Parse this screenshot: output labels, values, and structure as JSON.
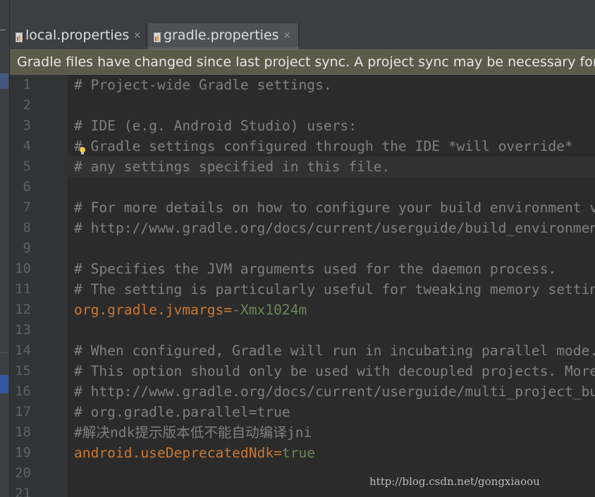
{
  "tabs": [
    {
      "label": "local.properties",
      "close": "×",
      "active": false
    },
    {
      "label": "gradle.properties",
      "close": "×",
      "active": true
    }
  ],
  "banner": {
    "message": "Gradle files have changed since last project sync. A project sync may be necessary for the IDE to work properly."
  },
  "editor": {
    "lines": [
      {
        "n": "1",
        "text": "# Project-wide Gradle settings."
      },
      {
        "n": "2",
        "text": ""
      },
      {
        "n": "3",
        "text": "# IDE (e.g. Android Studio) users:"
      },
      {
        "n": "4",
        "text": "# Gradle settings configured through the IDE *will override*"
      },
      {
        "n": "5",
        "text": "# any settings specified in this file."
      },
      {
        "n": "6",
        "text": ""
      },
      {
        "n": "7",
        "text": "# For more details on how to configure your build environment visit"
      },
      {
        "n": "8",
        "text": "# http://www.gradle.org/docs/current/userguide/build_environment.html"
      },
      {
        "n": "9",
        "text": ""
      },
      {
        "n": "10",
        "text": "# Specifies the JVM arguments used for the daemon process."
      },
      {
        "n": "11",
        "text": "# The setting is particularly useful for tweaking memory settings."
      },
      {
        "n": "12",
        "key": "org.gradle.jvmargs",
        "eq": "=",
        "value": "-Xmx1024m"
      },
      {
        "n": "13",
        "text": ""
      },
      {
        "n": "14",
        "text": "# When configured, Gradle will run in incubating parallel mode."
      },
      {
        "n": "15",
        "text": "# This option should only be used with decoupled projects. More details, visit"
      },
      {
        "n": "16",
        "text": "# http://www.gradle.org/docs/current/userguide/multi_project_builds.html#sec:decoupled_projects"
      },
      {
        "n": "17",
        "text": "# org.gradle.parallel=true"
      },
      {
        "n": "18",
        "text": "#解决ndk提示版本低不能自动编译jni"
      },
      {
        "n": "19",
        "key": "android.useDeprecatedNdk",
        "eq": "=",
        "value": "true"
      },
      {
        "n": "20",
        "text": ""
      },
      {
        "n": "21",
        "text": ""
      }
    ]
  },
  "watermark": "http://blog.csdn.net/gongxiaoou",
  "colors": {
    "comment": "#808080",
    "key": "#cc7832",
    "value": "#6a8759",
    "banner_bg": "#5b5b49",
    "editor_bg": "#2b2b2b",
    "gutter_bg": "#313335",
    "line_number": "#606366"
  },
  "icons": {
    "tab_file": "properties-file-icon",
    "intention": "lightbulb-icon"
  }
}
